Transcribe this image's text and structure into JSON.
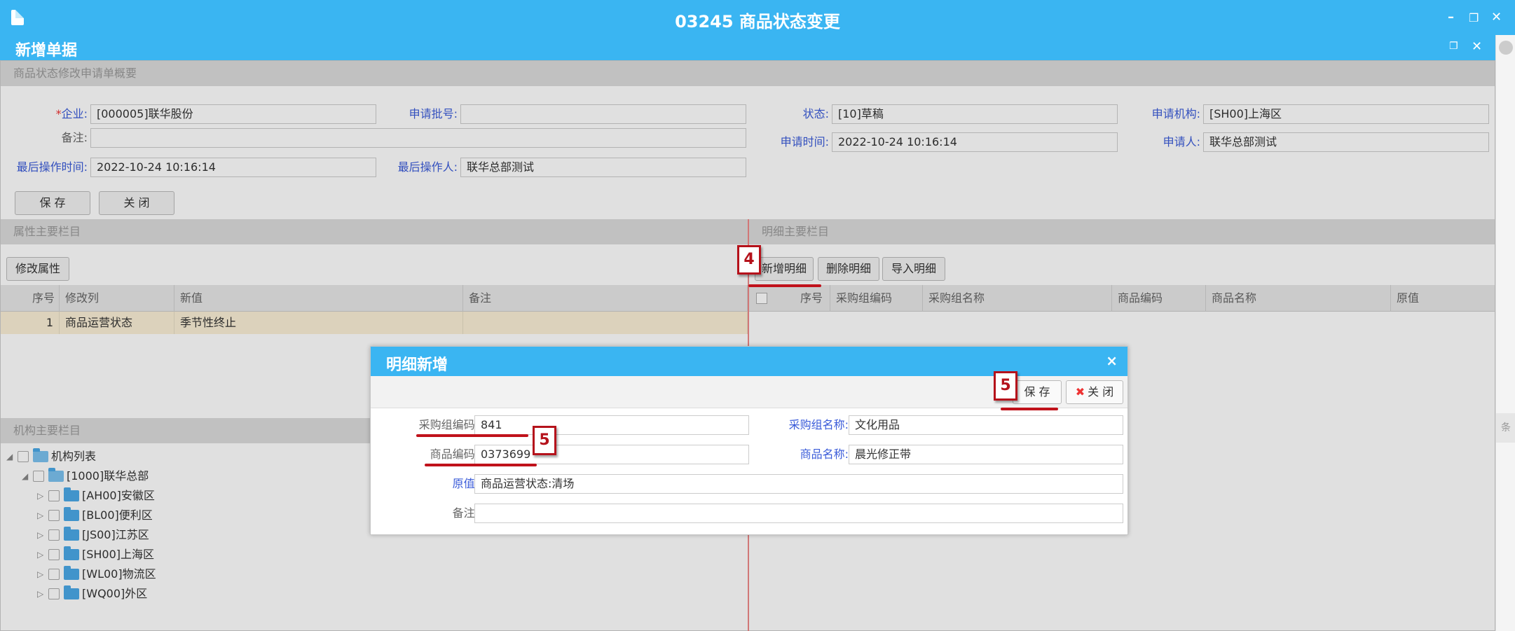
{
  "window": {
    "title": "03245 商品状态变更"
  },
  "subwindow": {
    "title": "新增单据"
  },
  "summary": {
    "section_title": "商品状态修改申请单概要",
    "company_label": "企业:",
    "company_value": "[000005]联华股份",
    "batch_label": "申请批号:",
    "batch_value": "",
    "status_label": "状态:",
    "status_value": "[10]草稿",
    "org_label": "申请机构:",
    "org_value": "[SH00]上海区",
    "remark_label": "备注:",
    "remark_value": "",
    "apply_time_label": "申请时间:",
    "apply_time_value": "2022-10-24 10:16:14",
    "applicant_label": "申请人:",
    "applicant_value": "联华总部测试",
    "last_op_time_label": "最后操作时间:",
    "last_op_time_value": "2022-10-24 10:16:14",
    "last_op_user_label": "最后操作人:",
    "last_op_user_value": "联华总部测试",
    "save_label": "保 存",
    "close_label": "关 闭"
  },
  "attr_panel": {
    "section_title": "属性主要栏目",
    "modify_btn": "修改属性",
    "columns": [
      "序号",
      "修改列",
      "新值",
      "备注"
    ],
    "rows": [
      {
        "no": "1",
        "col": "商品运营状态",
        "new": "季节性终止",
        "remark": ""
      }
    ]
  },
  "detail_panel": {
    "section_title": "明细主要栏目",
    "add_btn": "新增明细",
    "delete_btn": "删除明细",
    "import_btn": "导入明细",
    "columns": [
      "序号",
      "采购组编码",
      "采购组名称",
      "商品编码",
      "商品名称",
      "原值"
    ]
  },
  "org_panel": {
    "section_title": "机构主要栏目",
    "root": "机构列表",
    "hq": "[1000]联华总部",
    "regions": [
      "[AH00]安徽区",
      "[BL00]便利区",
      "[JS00]江苏区",
      "[SH00]上海区",
      "[WL00]物流区",
      "[WQ00]外区"
    ]
  },
  "modal": {
    "title": "明细新增",
    "save_label": "保 存",
    "close_label": "关 闭",
    "pg_code_label": "采购组编码:",
    "pg_code_value": "841",
    "pg_name_label": "采购组名称:",
    "pg_name_value": "文化用品",
    "goods_code_label": "商品编码:",
    "goods_code_value": "0373699",
    "goods_name_label": "商品名称:",
    "goods_name_value": "晨光修正带",
    "orig_label": "原值:",
    "orig_value": "商品运营状态:清场",
    "remark_label": "备注:",
    "remark_value": ""
  },
  "right_strip": {
    "tab_label": "条"
  },
  "annotations": {
    "step4": "4",
    "step5a": "5",
    "step5b": "5"
  },
  "colors": {
    "accent": "#3ab5f2",
    "annotation": "#b5121b",
    "selected_row": "#fbf0d6"
  }
}
